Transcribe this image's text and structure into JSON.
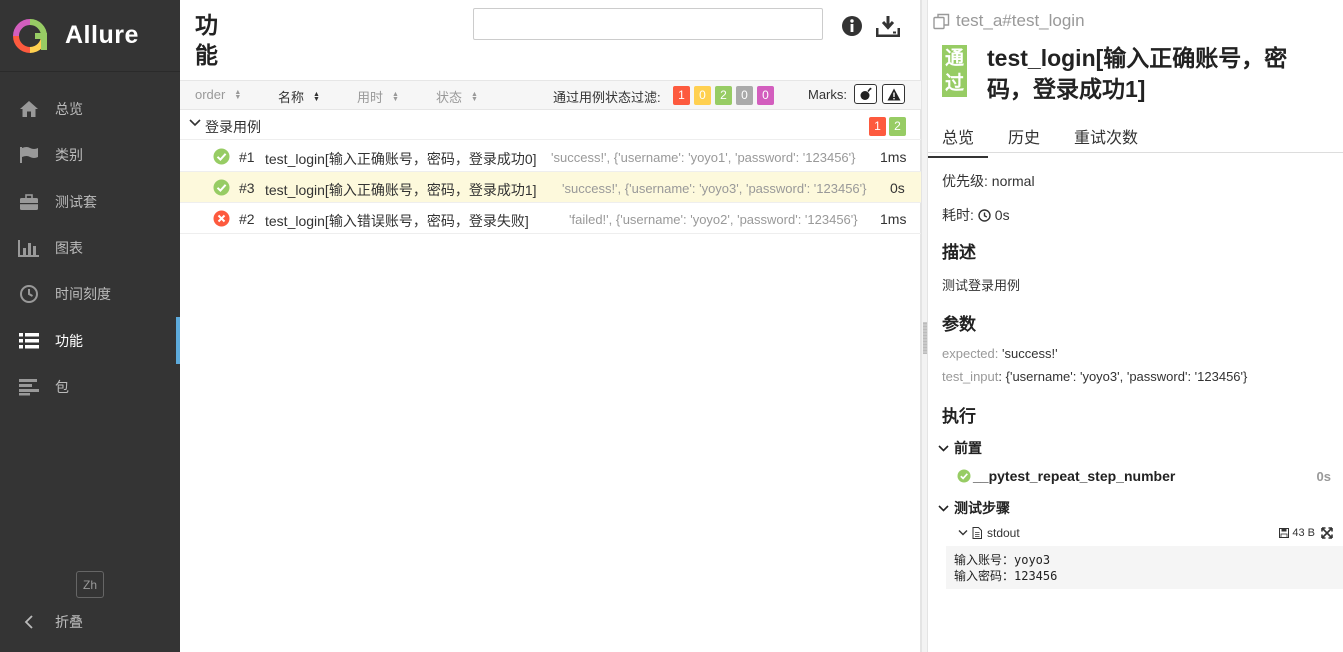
{
  "app": {
    "name": "Allure"
  },
  "sidebar": {
    "items": [
      {
        "label": "总览",
        "icon": "home-icon"
      },
      {
        "label": "类别",
        "icon": "flag-icon"
      },
      {
        "label": "测试套",
        "icon": "briefcase-icon"
      },
      {
        "label": "图表",
        "icon": "bar-chart-icon"
      },
      {
        "label": "时间刻度",
        "icon": "clock-icon"
      },
      {
        "label": "功能",
        "icon": "list-icon",
        "active": true
      },
      {
        "label": "包",
        "icon": "align-left-icon"
      }
    ],
    "lang_button": "Zh",
    "collapse_label": "折叠"
  },
  "middle": {
    "title": "功能",
    "search": {
      "value": "",
      "placeholder": ""
    },
    "sort_columns": [
      "order",
      "名称",
      "用时",
      "状态"
    ],
    "active_sort": "名称",
    "filter_label": "通过用例状态过滤:",
    "filter_counts": {
      "failed": "1",
      "broken": "0",
      "passed": "2",
      "skipped": "0",
      "unknown": "0"
    },
    "marks_label": "Marks:",
    "group": {
      "name": "登录用例",
      "failed": "1",
      "passed": "2"
    },
    "rows": [
      {
        "status": "passed",
        "num": "#1",
        "name": "test_login[输入正确账号，密码，登录成功0]",
        "params": "'success!', {'username': 'yoyo1', 'password': '123456'}",
        "duration": "1ms",
        "selected": false
      },
      {
        "status": "passed",
        "num": "#3",
        "name": "test_login[输入正确账号，密码，登录成功1]",
        "params": "'success!', {'username': 'yoyo3', 'password': '123456'}",
        "duration": "0s",
        "selected": true
      },
      {
        "status": "failed",
        "num": "#2",
        "name": "test_login[输入错误账号，密码，登录失败]",
        "params": "'failed!', {'username': 'yoyo2', 'password': '123456'}",
        "duration": "1ms",
        "selected": false
      }
    ]
  },
  "detail": {
    "breadcrumb": "test_a#test_login",
    "status_text": [
      "通",
      "过"
    ],
    "title": "test_login[输入正确账号，密码，登录成功1]",
    "tabs": [
      "总览",
      "历史",
      "重试次数"
    ],
    "priority_label": "优先级:",
    "priority_value": "normal",
    "duration_label": "耗时:",
    "duration_value": "0s",
    "description_heading": "描述",
    "description": "测试登录用例",
    "params_heading": "参数",
    "params": [
      {
        "key": "expected",
        "value": "'success!'"
      },
      {
        "key": "test_input",
        "value": "{'username': 'yoyo3', 'password': '123456'}"
      }
    ],
    "execution_heading": "执行",
    "setup_heading": "前置",
    "setup_step": {
      "name": "__pytest_repeat_step_number",
      "duration": "0s"
    },
    "body_heading": "测试步骤",
    "attachment": {
      "name": "stdout",
      "size": "43 B"
    },
    "stdout_lines": [
      "输入账号：yoyo3",
      "输入密码：123456"
    ]
  },
  "colors": {
    "sidebar_bg": "#343434",
    "passed": "#97cc64",
    "failed": "#fd5a3e",
    "broken": "#ffd050",
    "skipped": "#aaaaaa",
    "unknown": "#d35ebe",
    "active_accent": "#5daadb",
    "selected_row": "#fdf9dc"
  }
}
